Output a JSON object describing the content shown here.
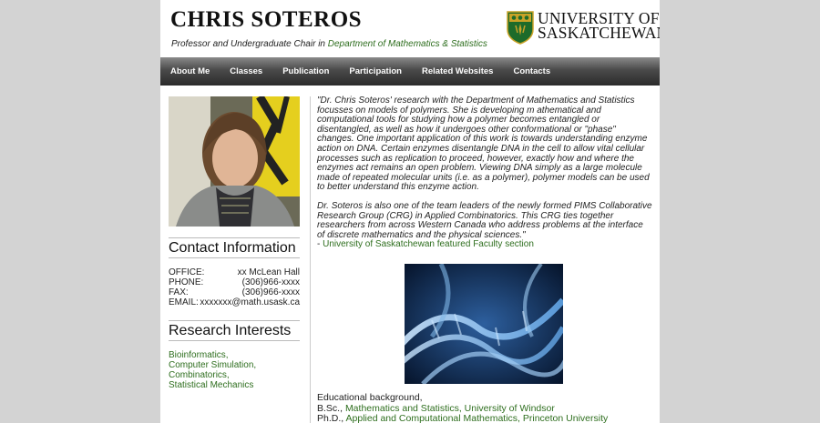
{
  "header": {
    "name": "CHRIS SOTEROS",
    "subtitle_prefix": "Professor and Undergraduate Chair in ",
    "subtitle_link": "Department of Mathematics & Statistics",
    "university_line1": "UNIVERSITY OF",
    "university_line2": "SASKATCHEWAN"
  },
  "nav": {
    "items": [
      "About Me",
      "Classes",
      "Publication",
      "Participation",
      "Related Websites",
      "Contacts"
    ]
  },
  "contact": {
    "title": "Contact Information",
    "rows": [
      {
        "label": "OFFICE:",
        "value": "xx McLean Hall"
      },
      {
        "label": "PHONE:",
        "value": "(306)966-xxxx"
      },
      {
        "label": "FAX:",
        "value": "(306)966-xxxx"
      },
      {
        "label": "EMAIL:",
        "value": "xxxxxxx@math.usask.ca"
      }
    ]
  },
  "research": {
    "title": "Research Interests",
    "items": [
      "Bioinformatics,",
      "Computer Simulation,",
      "Combinatorics,",
      "Statistical Mechanics"
    ]
  },
  "main": {
    "quote1": "\"Dr. Chris Soteros' research with the Department of Mathematics and Statistics focusses on models of polymers. She is developing m athematical and computational tools for studying how a polymer becomes entangled or disentangled, as well as how it undergoes other conformational or \"phase\" changes. One important application of this work is towards understanding enzyme action on DNA. Certain enzymes disentangle DNA in the cell to allow vital cellular processes such as replication to proceed, however, exactly how and where the enzymes act remains an open problem. Viewing DNA simply as a large molecule made of repeated molecular units (i.e. as a polymer), polymer models can be used to better understand this enzyme action.",
    "quote2": "Dr. Soteros is also one of the team leaders of the newly formed PIMS Collaborative Research Group (CRG) in Applied Combinatorics. This CRG ties together researchers from across Western Canada who address problems at the interface of discrete mathematics and the physical sciences.\"",
    "source_prefix": "- ",
    "source_link": "University of Saskatchewan featured Faculty section",
    "edu_heading": "Educational background,",
    "bsc_prefix": "B.Sc., ",
    "bsc_link": "Mathematics and Statistics, University of Windsor",
    "phd_prefix": "Ph.D., ",
    "phd_link": "Applied and Computational Mathematics, Princeton University"
  },
  "colors": {
    "link_green": "#2e6e1e",
    "background_gray": "#d3d3d3",
    "nav_dark": "#2b2b2b"
  }
}
